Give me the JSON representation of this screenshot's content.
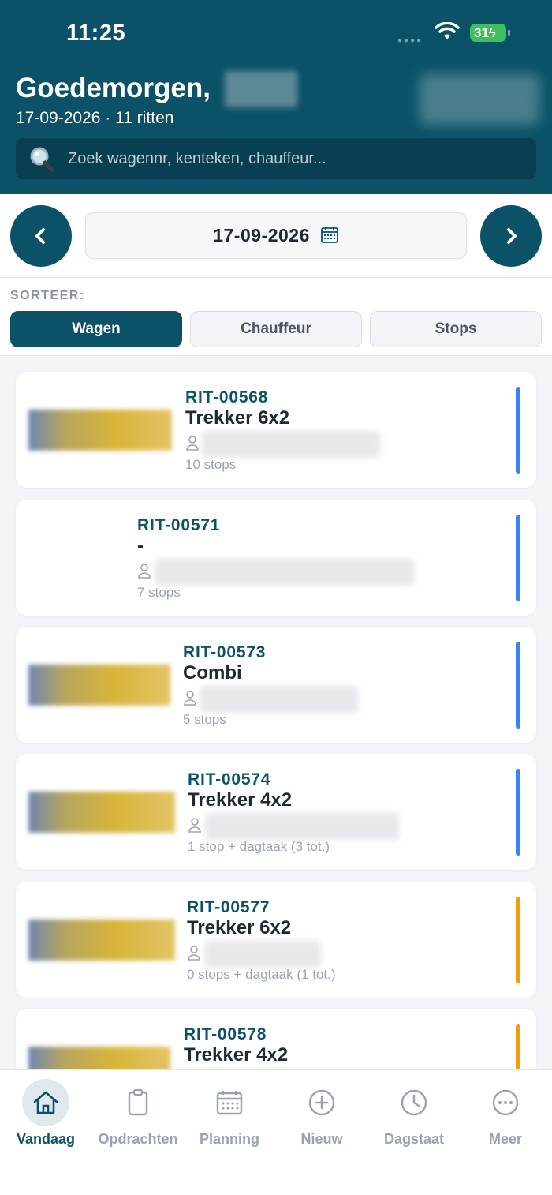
{
  "status_bar": {
    "time": "11:25",
    "battery": "31"
  },
  "header": {
    "greeting": "Goedemorgen,",
    "date": "17-09-2026",
    "separator": "·",
    "rides_count": "11 ritten",
    "search_placeholder": "Zoek wagennr, kenteken, chauffeur..."
  },
  "date_nav": {
    "date": "17-09-2026"
  },
  "sort": {
    "label": "SORTEER:",
    "options": [
      "Wagen",
      "Chauffeur",
      "Stops"
    ],
    "selected": "Wagen"
  },
  "rides": [
    {
      "id": "RIT-00568",
      "vehicle": "Trekker 6x2",
      "stops": "10 stops",
      "status_color": "#3b82f6"
    },
    {
      "id": "RIT-00571",
      "vehicle": "-",
      "stops": "7 stops",
      "status_color": "#3b82f6"
    },
    {
      "id": "RIT-00573",
      "vehicle": "Combi",
      "stops": "5 stops",
      "status_color": "#3b82f6"
    },
    {
      "id": "RIT-00574",
      "vehicle": "Trekker 4x2",
      "stops": "1 stop + dagtaak (3 tot.)",
      "status_color": "#3b82f6"
    },
    {
      "id": "RIT-00577",
      "vehicle": "Trekker 6x2",
      "stops": "0 stops + dagtaak (1 tot.)",
      "status_color": "#f59e0b"
    },
    {
      "id": "RIT-00578",
      "vehicle": "Trekker 4x2",
      "stops": "",
      "status_color": "#f59e0b"
    }
  ],
  "tabs": [
    {
      "label": "Vandaag",
      "icon": "home-icon",
      "active": true
    },
    {
      "label": "Opdrachten",
      "icon": "clipboard-icon",
      "active": false
    },
    {
      "label": "Planning",
      "icon": "calendar-icon",
      "active": false
    },
    {
      "label": "Nieuw",
      "icon": "plus-circle-icon",
      "active": false
    },
    {
      "label": "Dagstaat",
      "icon": "clock-icon",
      "active": false
    },
    {
      "label": "Meer",
      "icon": "more-icon",
      "active": false
    }
  ],
  "colors": {
    "primary": "#0b5268",
    "accent_blue": "#3b82f6",
    "accent_orange": "#f59e0b"
  }
}
